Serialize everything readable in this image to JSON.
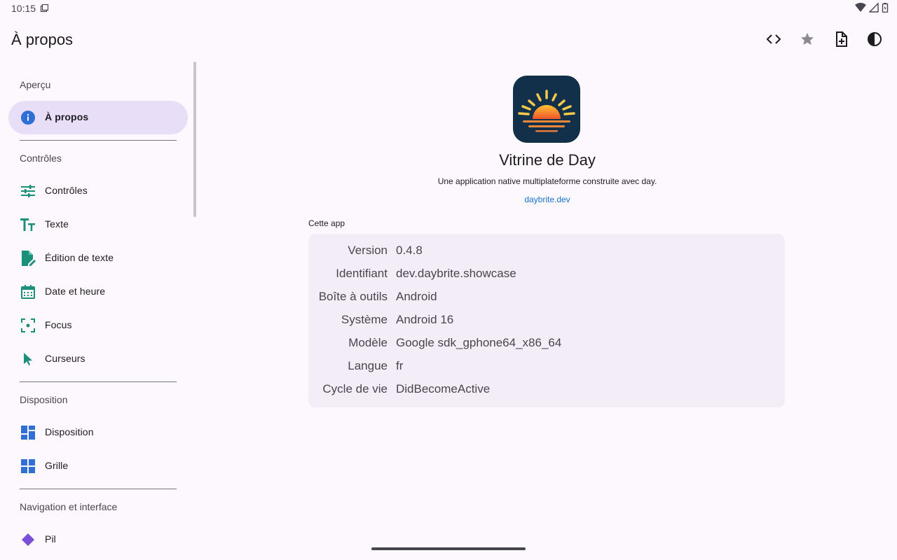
{
  "status_bar": {
    "time": "10:15"
  },
  "app_bar": {
    "title": "À propos",
    "actions": [
      {
        "name": "code-icon"
      },
      {
        "name": "star-icon"
      },
      {
        "name": "note-add-icon"
      },
      {
        "name": "contrast-icon"
      }
    ]
  },
  "sidebar": {
    "sections": [
      {
        "title": "Aperçu"
      },
      {
        "title": "Contrôles"
      },
      {
        "title": "Disposition"
      },
      {
        "title": "Navigation et interface"
      }
    ],
    "items": [
      {
        "label": "À propos",
        "icon": "info-icon",
        "active": true
      },
      {
        "label": "Contrôles",
        "icon": "tune-icon"
      },
      {
        "label": "Texte",
        "icon": "text-fields-icon"
      },
      {
        "label": "Édition de texte",
        "icon": "edit-note-icon"
      },
      {
        "label": "Date et heure",
        "icon": "calendar-icon"
      },
      {
        "label": "Focus",
        "icon": "focus-icon"
      },
      {
        "label": "Curseurs",
        "icon": "cursor-icon"
      },
      {
        "label": "Disposition",
        "icon": "dashboard-icon"
      },
      {
        "label": "Grille",
        "icon": "grid-icon"
      },
      {
        "label": "Pil",
        "icon": "diamond-icon"
      }
    ]
  },
  "main": {
    "app_name": "Vitrine de Day",
    "description": "Une application native multiplateforme construite avec day.",
    "link": "daybrite.dev",
    "card_caption": "Cette app",
    "info": [
      {
        "label": "Version",
        "value": "0.4.8"
      },
      {
        "label": "Identifiant",
        "value": "dev.daybrite.showcase"
      },
      {
        "label": "Boîte à outils",
        "value": "Android"
      },
      {
        "label": "Système",
        "value": "Android 16"
      },
      {
        "label": "Modèle",
        "value": "Google sdk_gphone64_x86_64"
      },
      {
        "label": "Langue",
        "value": "fr"
      },
      {
        "label": "Cycle de vie",
        "value": "DidBecomeActive"
      }
    ]
  },
  "colors": {
    "background": "#fdf7fe",
    "active_item": "#e8def8",
    "teal_icon": "#1a8f7a",
    "blue_icon": "#2f6fd6",
    "link": "#1a73c8",
    "card": "#f3edf7"
  }
}
